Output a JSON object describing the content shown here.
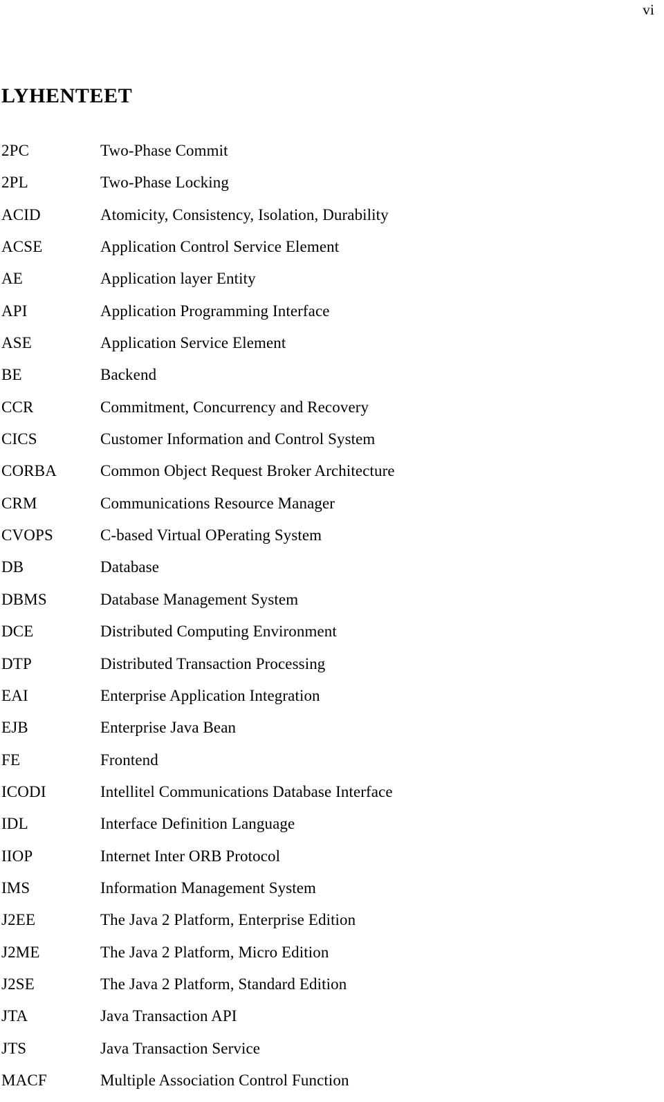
{
  "page": {
    "folio": "vi",
    "background_color": "#ffffff",
    "text_color": "#000000"
  },
  "section": {
    "title": "LYHENTEET"
  },
  "abbreviations": [
    {
      "term": "2PC",
      "definition": "Two-Phase Commit"
    },
    {
      "term": "2PL",
      "definition": "Two-Phase Locking"
    },
    {
      "term": "ACID",
      "definition": "Atomicity, Consistency, Isolation, Durability"
    },
    {
      "term": "ACSE",
      "definition": "Application Control Service Element"
    },
    {
      "term": "AE",
      "definition": "Application layer Entity"
    },
    {
      "term": "API",
      "definition": "Application Programming Interface"
    },
    {
      "term": "ASE",
      "definition": "Application Service Element"
    },
    {
      "term": "BE",
      "definition": "Backend"
    },
    {
      "term": "CCR",
      "definition": "Commitment, Concurrency and Recovery"
    },
    {
      "term": "CICS",
      "definition": "Customer Information and Control System"
    },
    {
      "term": "CORBA",
      "definition": "Common Object Request Broker Architecture"
    },
    {
      "term": "CRM",
      "definition": "Communications Resource Manager"
    },
    {
      "term": "CVOPS",
      "definition": "C-based Virtual OPerating System"
    },
    {
      "term": "DB",
      "definition": "Database"
    },
    {
      "term": "DBMS",
      "definition": "Database Management System"
    },
    {
      "term": "DCE",
      "definition": "Distributed Computing Environment"
    },
    {
      "term": "DTP",
      "definition": "Distributed Transaction Processing"
    },
    {
      "term": "EAI",
      "definition": "Enterprise Application Integration"
    },
    {
      "term": "EJB",
      "definition": "Enterprise Java Bean"
    },
    {
      "term": "FE",
      "definition": "Frontend"
    },
    {
      "term": "ICODI",
      "definition": "Intellitel Communications Database Interface"
    },
    {
      "term": "IDL",
      "definition": "Interface Definition Language"
    },
    {
      "term": "IIOP",
      "definition": "Internet Inter ORB Protocol"
    },
    {
      "term": "IMS",
      "definition": "Information Management System"
    },
    {
      "term": "J2EE",
      "definition": "The Java 2 Platform, Enterprise Edition"
    },
    {
      "term": "J2ME",
      "definition": "The Java 2 Platform, Micro Edition"
    },
    {
      "term": "J2SE",
      "definition": "The Java 2 Platform, Standard Edition"
    },
    {
      "term": "JTA",
      "definition": "Java Transaction API"
    },
    {
      "term": "JTS",
      "definition": "Java Transaction Service"
    },
    {
      "term": "MACF",
      "definition": "Multiple Association Control Function"
    }
  ]
}
